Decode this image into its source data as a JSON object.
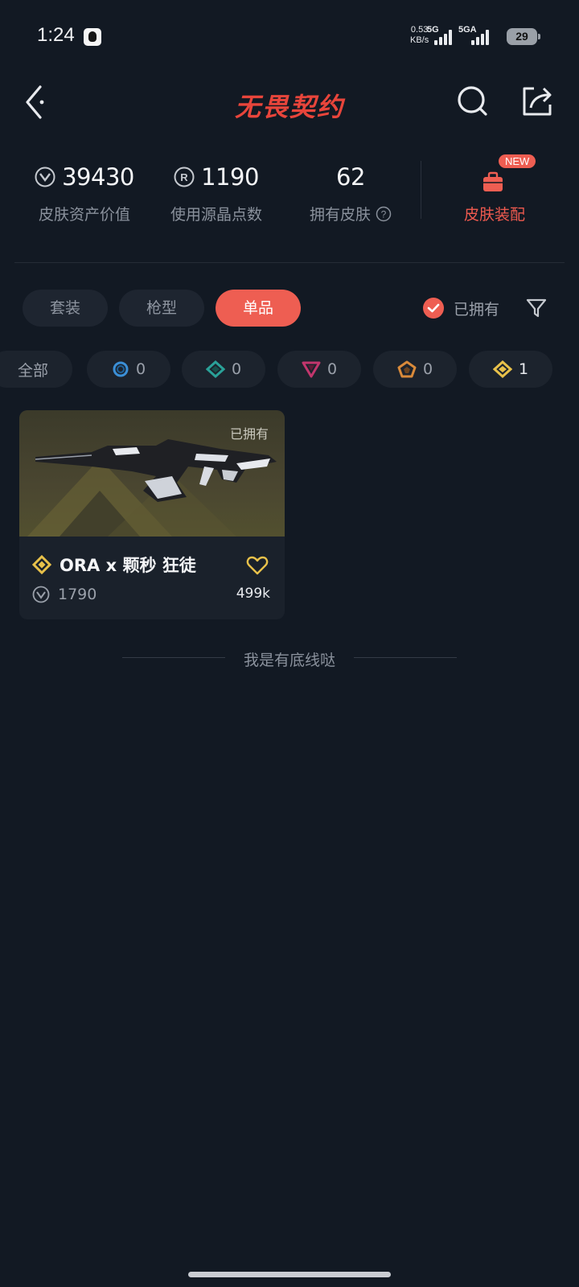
{
  "status_bar": {
    "time": "1:24",
    "net_speed_value": "0.53",
    "net_speed_unit": "KB/s",
    "sim1_label": "5G",
    "sim2_label": "5GA",
    "battery": "29"
  },
  "header": {
    "title": "无畏契约"
  },
  "stats": {
    "asset_value": "39430",
    "asset_label": "皮肤资产价值",
    "radianite_points": "1190",
    "radianite_label": "使用源晶点数",
    "owned_skins": "62",
    "owned_label": "拥有皮肤",
    "equip_label": "皮肤装配",
    "new_badge": "NEW"
  },
  "tabs": [
    {
      "label": "套装",
      "active": false
    },
    {
      "label": "枪型",
      "active": false
    },
    {
      "label": "单品",
      "active": true
    }
  ],
  "owned_filter": {
    "label": "已拥有",
    "checked": true
  },
  "rarity_chips": [
    {
      "label": "全部"
    },
    {
      "tier": "select",
      "count": "0",
      "color": "#3b8fd6"
    },
    {
      "tier": "deluxe",
      "count": "0",
      "color": "#2aa198"
    },
    {
      "tier": "premium",
      "count": "0",
      "color": "#c2366d"
    },
    {
      "tier": "exclusive",
      "count": "0",
      "color": "#d98a3a"
    },
    {
      "tier": "ultra",
      "count": "1",
      "color": "#e8c14a"
    }
  ],
  "items": [
    {
      "owned_tag": "已拥有",
      "name": "ORA x 颗秒 狂徒",
      "price": "1790",
      "likes": "499k",
      "tier_color": "#e8c14a"
    }
  ],
  "end_text": "我是有底线哒"
}
